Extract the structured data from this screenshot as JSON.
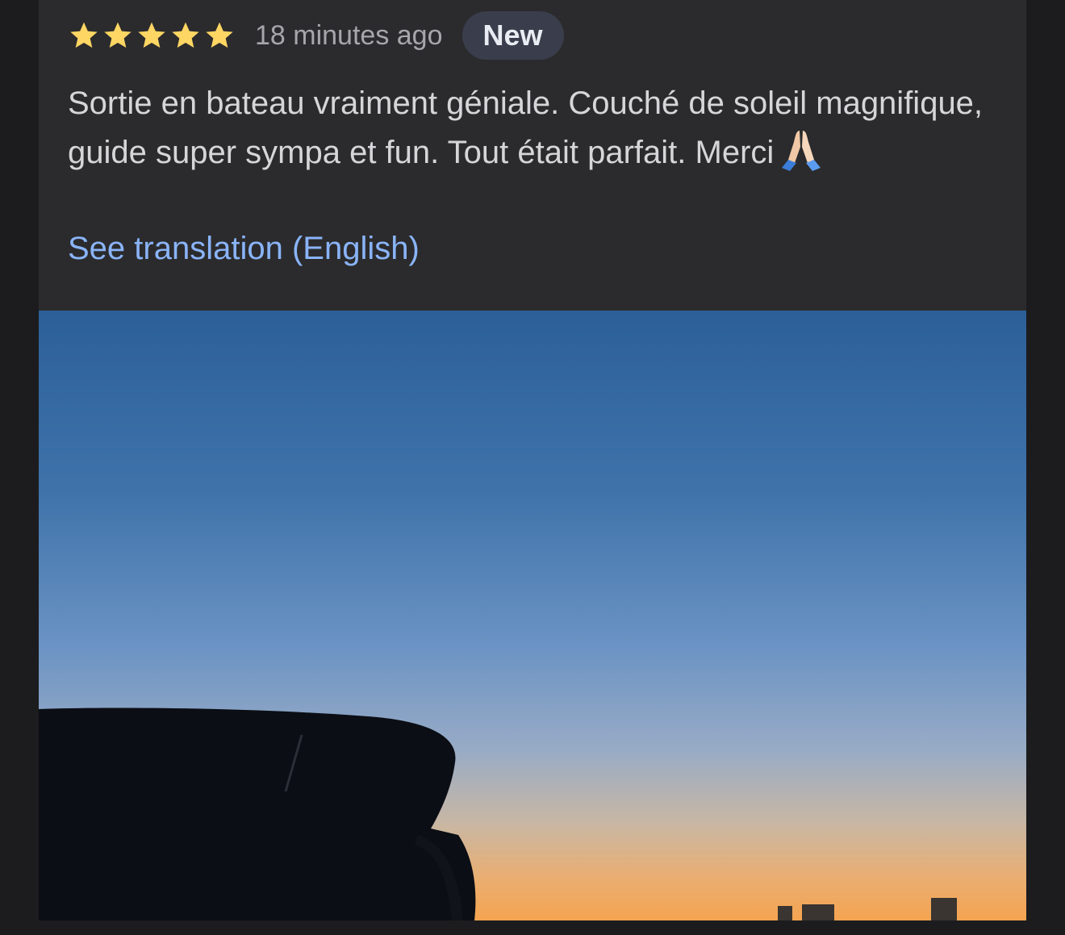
{
  "review": {
    "rating": 5,
    "max_rating": 5,
    "time_ago": "18 minutes ago",
    "badge": "New",
    "text": "Sortie en bateau vraiment géniale. Couché de soleil magnifique, guide super sympa et fun. Tout était parfait. Merci",
    "emoji_icon": "folded-hands-icon",
    "translation_link": "See translation (English)"
  },
  "colors": {
    "star": "#fdd663",
    "link": "#8ab4f8",
    "card_background": "#2b2b2d",
    "page_background": "#1c1c1e",
    "badge_background": "#3a3e4c"
  }
}
